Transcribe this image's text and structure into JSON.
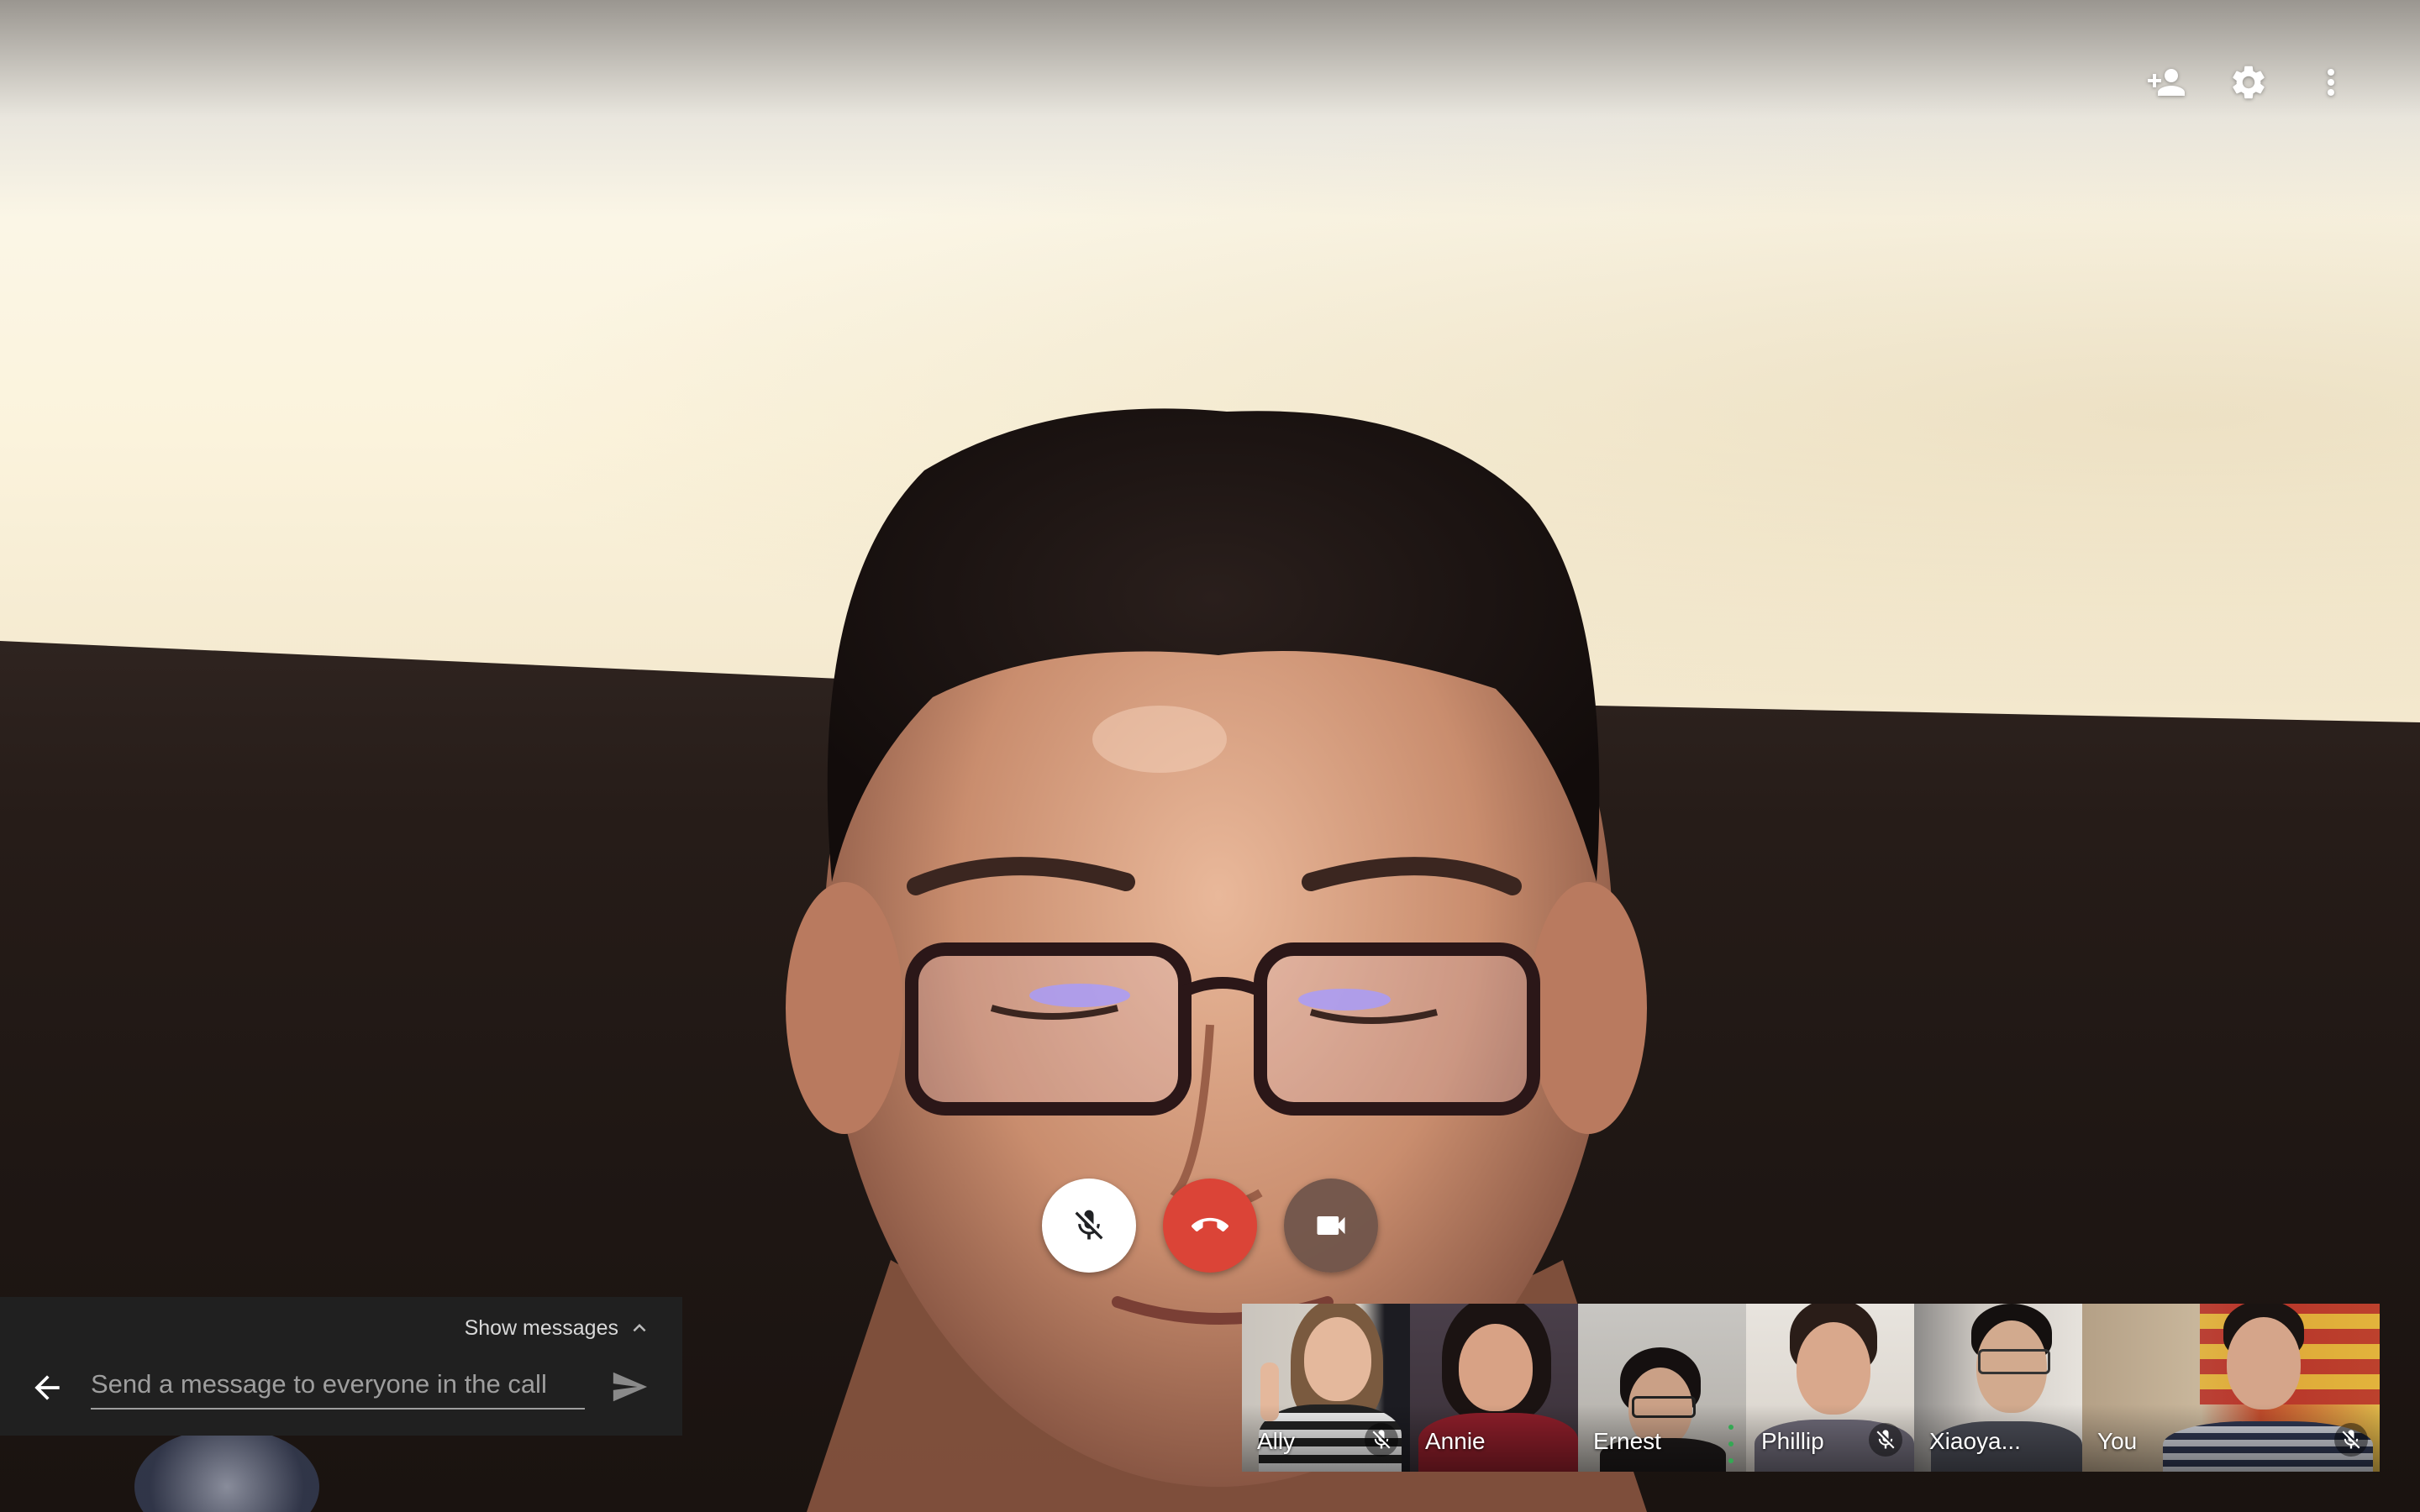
{
  "top_bar": {
    "icons": [
      {
        "name": "add-person-icon"
      },
      {
        "name": "settings-icon"
      },
      {
        "name": "more-options-icon"
      }
    ]
  },
  "controls": {
    "mic": {
      "icon": "mic-off-icon",
      "state": "muted"
    },
    "end_call": {
      "icon": "end-call-icon",
      "color": "#db4437"
    },
    "camera": {
      "icon": "videocam-icon"
    }
  },
  "chat": {
    "show_messages_label": "Show messages",
    "input_placeholder": "Send a message to everyone in the call",
    "input_value": ""
  },
  "participants": [
    {
      "name": "Ally",
      "muted": true
    },
    {
      "name": "Annie",
      "muted": false
    },
    {
      "name": "Ernest",
      "muted": false,
      "speaking": true
    },
    {
      "name": "Phillip",
      "muted": true
    },
    {
      "name": "Xiaoya...",
      "muted": false
    },
    {
      "name": "You",
      "muted": true
    }
  ],
  "colors": {
    "end_call": "#db4437",
    "chat_panel": "#202020",
    "speaking_indicator": "#34a853"
  }
}
